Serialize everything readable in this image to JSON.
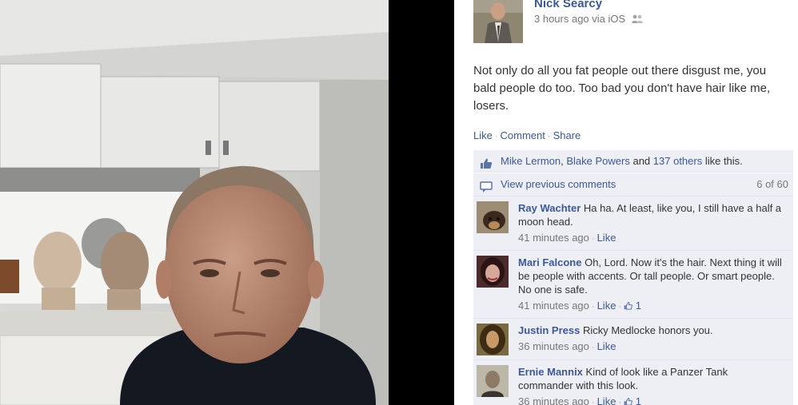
{
  "post": {
    "author": "Nick Searcy",
    "time": "3 hours ago",
    "via": "via iOS",
    "text": "Not only do all you fat people out there disgust me, you bald people do too. Too bad you don't have hair like me, losers."
  },
  "actions": {
    "like": "Like",
    "comment": "Comment",
    "share": "Share"
  },
  "likes": {
    "name1": "Mike Lermon",
    "sep": ", ",
    "name2": "Blake Powers",
    "and": " and ",
    "others": "137 others",
    "suffix": " like this."
  },
  "previous": {
    "label": "View previous comments",
    "count": "6 of 60"
  },
  "comments": [
    {
      "name": "Ray Wachter",
      "text": "Ha ha. At least, like you, I still have a half a moon head.",
      "time": "41 minutes ago",
      "like": "Like",
      "like_count": ""
    },
    {
      "name": "Mari Falcone",
      "text": "Oh, Lord. Now it's the hair. Next thing it will be people with accents. Or tall people. Or smart people. No one is safe.",
      "time": "41 minutes ago",
      "like": "Like",
      "like_count": "1"
    },
    {
      "name": "Justin Press",
      "text": "Ricky Medlocke honors you.",
      "time": "36 minutes ago",
      "like": "Like",
      "like_count": ""
    },
    {
      "name": "Ernie Mannix",
      "text": "Kind of look like a Panzer Tank commander with this look.",
      "time": "36 minutes ago",
      "like": "Like",
      "like_count": "1"
    }
  ],
  "icons": {
    "like": "thumbs-up-icon",
    "comments": "speech-bubble-icon",
    "friends": "friends-icon"
  },
  "colors": {
    "link": "#3b5998",
    "ufi_bg": "#edeff4",
    "meta": "#777777"
  }
}
